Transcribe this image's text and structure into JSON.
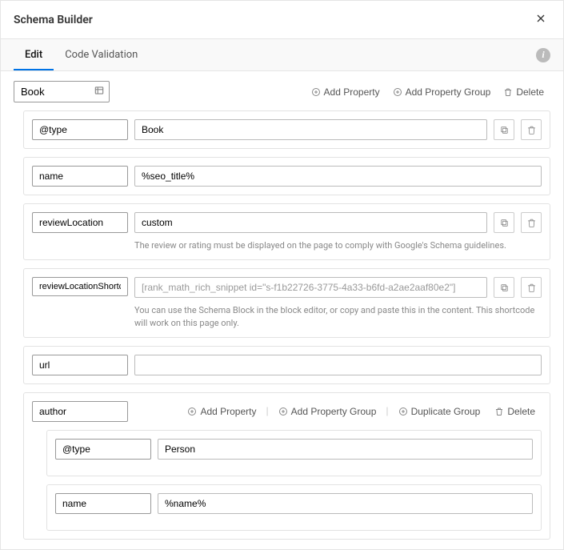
{
  "modal": {
    "title": "Schema Builder"
  },
  "tabs": {
    "edit": "Edit",
    "validate": "Code Validation"
  },
  "toolbar": {
    "schema_type": "Book",
    "add_property": "Add Property",
    "add_property_group": "Add Property Group",
    "delete": "Delete"
  },
  "props": {
    "type": {
      "key": "@type",
      "value": "Book"
    },
    "name": {
      "key": "name",
      "value": "%seo_title%"
    },
    "reviewLocation": {
      "key": "reviewLocation",
      "value": "custom",
      "help": "The review or rating must be displayed on the page to comply with Google's Schema guidelines."
    },
    "reviewLocationShortcode": {
      "key": "reviewLocationShortcode",
      "placeholder": "[rank_math_rich_snippet id=\"s-f1b22726-3775-4a33-b6fd-a2ae2aaf80e2\"]",
      "help": "You can use the Schema Block in the block editor, or copy and paste this in the content. This shortcode will work on this page only."
    },
    "url": {
      "key": "url",
      "value": ""
    }
  },
  "author": {
    "key": "author",
    "actions": {
      "add_property": "Add Property",
      "add_property_group": "Add Property Group",
      "duplicate_group": "Duplicate Group",
      "delete": "Delete"
    },
    "props": {
      "type": {
        "key": "@type",
        "value": "Person"
      },
      "name": {
        "key": "name",
        "value": "%name%"
      }
    }
  }
}
